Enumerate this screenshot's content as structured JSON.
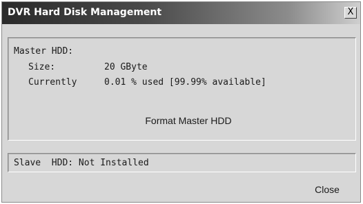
{
  "window": {
    "title": "DVR Hard Disk Management",
    "close_glyph": "X"
  },
  "master": {
    "heading": "Master HDD:",
    "size_label": "Size:",
    "size_value": "20 GByte",
    "usage_label": "Currently",
    "usage_value": "0.01 % used [99.99% available]",
    "format_label": "Format Master HDD"
  },
  "slave": {
    "status": "Slave  HDD: Not Installed"
  },
  "footer": {
    "close_label": "Close"
  }
}
